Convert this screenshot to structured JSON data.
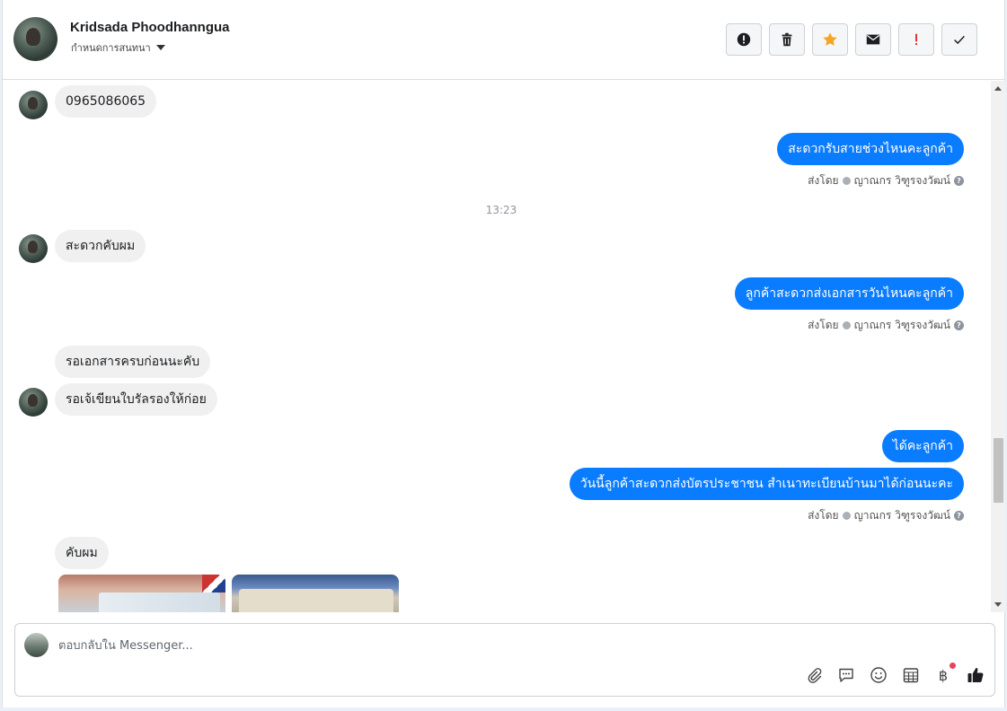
{
  "header": {
    "contact_name": "Kridsada Phoodhanngua",
    "assign_label": "กำหนดการสนทนา",
    "actions": [
      {
        "name": "report-spam",
        "icon": "alert-circle-icon"
      },
      {
        "name": "delete",
        "icon": "trash-icon"
      },
      {
        "name": "star",
        "icon": "star-icon",
        "color": "#f5a623"
      },
      {
        "name": "mark-unread",
        "icon": "envelope-icon"
      },
      {
        "name": "follow-up",
        "icon": "exclamation-icon",
        "color": "#e02020"
      },
      {
        "name": "mark-done",
        "icon": "checkmark-icon"
      }
    ]
  },
  "messages": {
    "m1": "0965086065",
    "m2": "สะดวกรับสายช่วงไหนคะลูกค้า",
    "timestamp": "13:23",
    "m3": "สะดวกคับผม",
    "m4": "ลูกค้าสะดวกส่งเอกสารวันไหนคะลูกค้า",
    "m5": "รอเอกสารครบก่อนนะคับ",
    "m6": "รอเจ้เขียนใบรัลรองให้ก่อย",
    "m7": "ได้คะลูกค้า",
    "m8": "วันนี้ลูกค้าสะดวกส่งบัตรประชาชน สำเนาทะเบียนบ้านมาได้ก่อนนะคะ",
    "m9": "คับผม",
    "sent_by_prefix": "ส่งโดย",
    "sent_by_name": "ญาณกร วิฑูรจงวัฒน์"
  },
  "composer": {
    "placeholder": "ตอบกลับใน Messenger...",
    "tools": [
      "paperclip-icon",
      "saved-reply-icon",
      "emoji-icon",
      "calendar-icon",
      "baht-icon",
      "thumbs-up-icon"
    ],
    "baht_symbol": "฿"
  },
  "colors": {
    "outgoing_bubble": "#0a7cff",
    "incoming_bubble": "#f0f0f0"
  }
}
